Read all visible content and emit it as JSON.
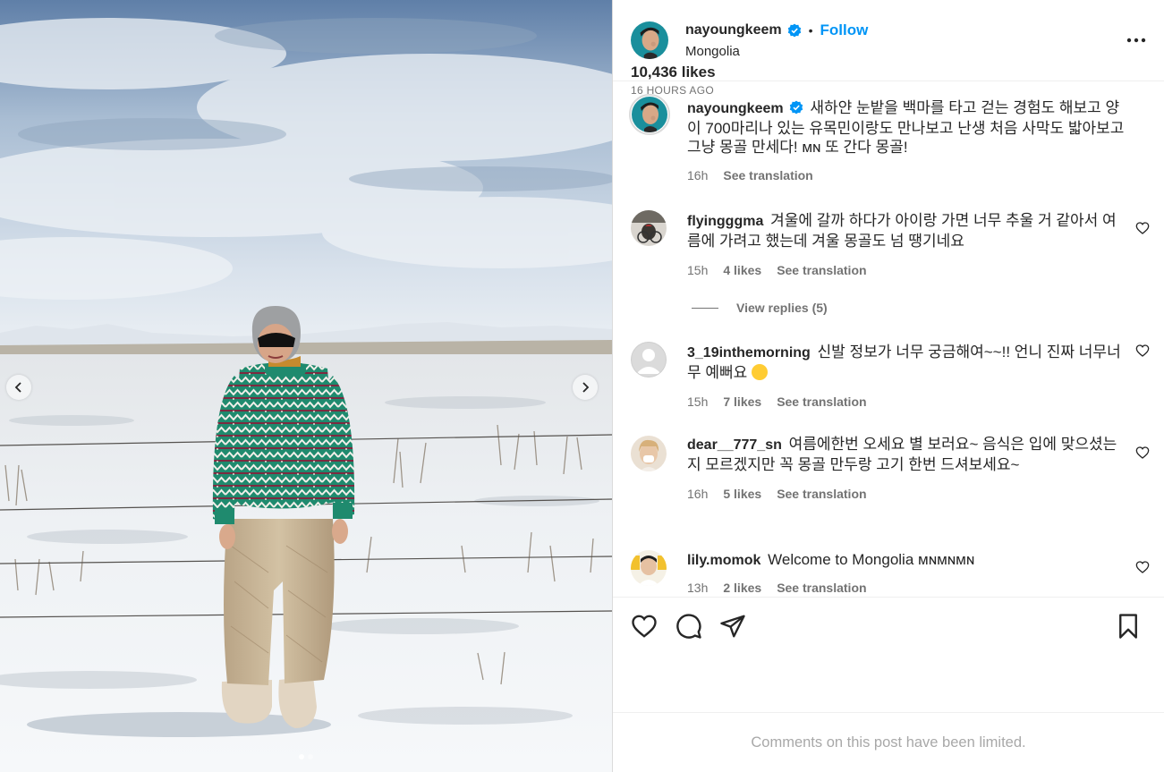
{
  "post": {
    "username": "nayoungkeem",
    "follow_label": "Follow",
    "separator": "•",
    "location": "Mongolia",
    "caption": "새하얀 눈밭을 백마를 타고 걷는 경험도 해보고 양이 700마리나 있는 유목민이랑도 만나보고 난생 처음 사막도 밟아보고 그냥 몽골 만세다! ᴍɴ 또 간다 몽골!",
    "caption_time": "16h",
    "see_translation": "See translation",
    "likes_label": "10,436 likes",
    "posted_ago": "16 HOURS AGO",
    "comments_limited": "Comments on this post have been limited."
  },
  "comments": [
    {
      "username": "flyingggma",
      "text": "겨울에 갈까 하다가 아이랑 가면 너무 추울 거 같아서 여름에 가려고 했는데 겨울 몽골도 넘 땡기네요",
      "time": "15h",
      "likes": "4 likes",
      "translate": "See translation"
    },
    {
      "username": "3_19inthemorning",
      "text": "신발 정보가 너무 궁금해여~~!! 언니 진짜 너무너무 예뻐요",
      "time": "15h",
      "likes": "7 likes",
      "translate": "See translation"
    },
    {
      "username": "dear__777_sn",
      "text": "여름에한번 오세요 별 보러요~ 음식은 입에 맞으셨는지 모르겠지만 꼭 몽골 만두랑 고기 한번 드셔보세요~",
      "time": "16h",
      "likes": "5 likes",
      "translate": "See translation"
    },
    {
      "username": "lily.momok",
      "text": "Welcome to Mongolia ᴍɴᴍɴᴍɴ",
      "time": "13h",
      "likes": "2 likes",
      "translate": "See translation"
    }
  ],
  "view_replies": "View replies (5)",
  "icons": {
    "verified": "verified-badge-icon",
    "more": "more-options-icon",
    "like": "heart-icon",
    "comment": "comment-icon",
    "share": "share-icon",
    "save": "bookmark-icon",
    "prev": "chevron-left-icon",
    "next": "chevron-right-icon"
  },
  "colors": {
    "follow": "#0095f6",
    "verified": "#0095f6",
    "muted": "#737373",
    "text": "#262626"
  },
  "carousel": {
    "total": 2,
    "active": 1
  }
}
